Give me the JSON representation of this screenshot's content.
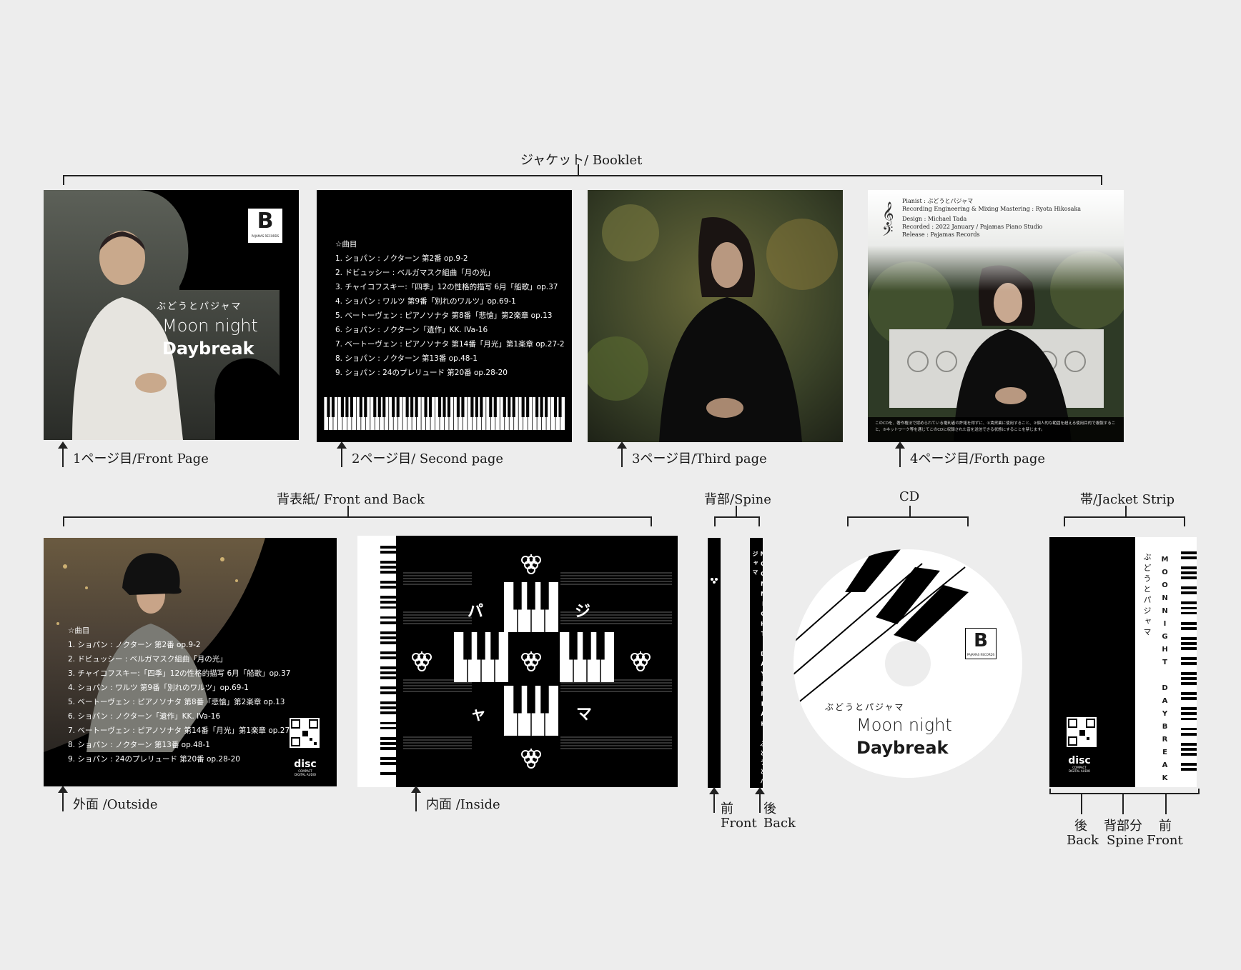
{
  "booklet": {
    "section_label": "ジャケット/ Booklet",
    "front": {
      "caption": "1ページ目/Front Page",
      "artist": "ぶどうとパジャマ",
      "title_1": "Moon night",
      "title_2": "Daybreak",
      "logo_letter": "B",
      "logo_text": "PAJAMAS RECORDS"
    },
    "second": {
      "caption": "2ページ目/ Second page",
      "tracks_heading": "☆曲目",
      "tracks": [
        "1. ショパン : ノクターン 第2番 op.9-2",
        "2. ドビュッシー : ベルガマスク組曲「月の光」",
        "3. チャイコフスキー:「四季」12の性格的描写 6月「船歌」op.37",
        "4. ショパン : ワルツ 第9番「別れのワルツ」op.69-1",
        "5. ベートーヴェン : ピアノソナタ 第8番「悲愴」第2楽章 op.13",
        "6. ショパン : ノクターン「遺作」KK. IVa-16",
        "7. ベートーヴェン : ピアノソナタ 第14番「月光」第1楽章 op.27-2",
        "8. ショパン : ノクターン 第13番 op.48-1",
        "9. ショパン : 24のプレリュード 第20番 op.28-20"
      ]
    },
    "third": {
      "caption": "3ページ目/Third page"
    },
    "fourth": {
      "caption": "4ページ目/Forth page",
      "credits": [
        "Pianist : ぶどうとパジャマ",
        "Recording Engineering & Mixing Mastering : Ryota Hikosaka",
        "Design : Michael Tada",
        "Recorded : 2022 January / Pajamas Piano Studio",
        "Release : Pajamas Records"
      ],
      "notice": "このCDを、著作権法で認められている権利者の許諾を得ずに、①賃貸業に使用すること、②個人的な範囲を超える使用目的で複製すること、③ネットワーク等を通じてこのCDに収録された音を送信できる状態にすることを禁じます。"
    }
  },
  "back_cover": {
    "section_label": "背表紙/ Front and Back",
    "outside_caption": "外面 /Outside",
    "inside_caption": "内面 /Inside",
    "inside_kana": [
      "パ",
      "ジ",
      "ャ",
      "マ"
    ],
    "disc_logo_1": "disc",
    "disc_logo_2": "COMPACT DIGITAL AUDIO"
  },
  "spine": {
    "section_label": "背部/Spine",
    "front_jp": "前",
    "front_en": "Front",
    "back_jp": "後",
    "back_en": "Back",
    "text": "MOONNIGHT DAYBREAK ぶどうとパジャマ"
  },
  "cd": {
    "section_label": "CD",
    "artist": "ぶどうとパジャマ",
    "title_1": "Moon night",
    "title_2": "Daybreak"
  },
  "strip": {
    "section_label": "帯/Jacket Strip",
    "artist_vertical": "ぶどうとパジャマ",
    "title_vertical": "MOONNIGHT DAYBREAK",
    "back_jp": "後",
    "back_en": "Back",
    "spine_jp": "背部分",
    "spine_en": "Spine",
    "front_jp": "前",
    "front_en": "Front"
  }
}
